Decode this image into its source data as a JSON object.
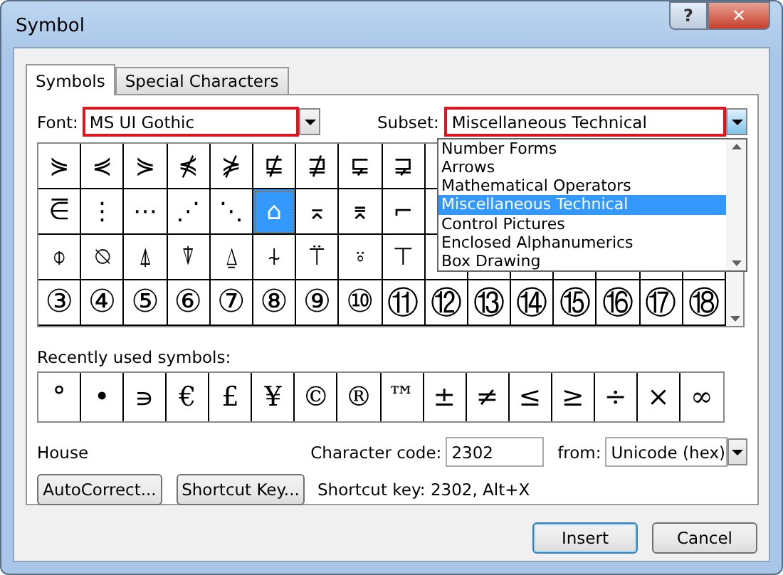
{
  "window": {
    "title": "Symbol",
    "help_button": "?",
    "close_button": "✕"
  },
  "tabs": [
    {
      "label": "Symbols",
      "selected": true
    },
    {
      "label": "Special Characters",
      "selected": false
    }
  ],
  "font": {
    "label": "Font:",
    "value": "MS UI Gothic",
    "highlighted": true
  },
  "subset": {
    "label": "Subset:",
    "value": "Miscellaneous Technical",
    "highlighted": true,
    "expanded": true,
    "options": [
      {
        "label": "Number Forms",
        "selected": false
      },
      {
        "label": "Arrows",
        "selected": false
      },
      {
        "label": "Mathematical Operators",
        "selected": false
      },
      {
        "label": "Miscellaneous Technical",
        "selected": true
      },
      {
        "label": "Control Pictures",
        "selected": false
      },
      {
        "label": "Enclosed Alphanumerics",
        "selected": false
      },
      {
        "label": "Box Drawing",
        "selected": false
      }
    ]
  },
  "symbol_grid": [
    [
      {
        "char": "⋟",
        "selected": false
      },
      {
        "char": "⋞",
        "selected": false
      },
      {
        "char": "⋟",
        "selected": false
      },
      {
        "char": "⋠",
        "selected": false
      },
      {
        "char": "⋡",
        "selected": false
      },
      {
        "char": "⋢",
        "selected": false
      },
      {
        "char": "⋣",
        "selected": false
      },
      {
        "char": "⋤",
        "selected": false
      },
      {
        "char": "⋥",
        "selected": false
      }
    ],
    [
      {
        "char": "⋶",
        "selected": false
      },
      {
        "char": "⋮",
        "selected": false
      },
      {
        "char": "⋯",
        "selected": false
      },
      {
        "char": "⋰",
        "selected": false
      },
      {
        "char": "⋱",
        "selected": false
      },
      {
        "char": "⌂",
        "selected": true
      },
      {
        "char": "⌅",
        "selected": false
      },
      {
        "char": "⌆",
        "selected": false
      },
      {
        "char": "⌐",
        "selected": false
      }
    ],
    [
      {
        "char": "⌽",
        "selected": false
      },
      {
        "char": "⍉",
        "selected": false
      },
      {
        "char": "⍋",
        "selected": false
      },
      {
        "char": "⍒",
        "selected": false
      },
      {
        "char": "⍙",
        "selected": false
      },
      {
        "char": "⍭",
        "selected": false
      },
      {
        "char": "⍡",
        "selected": false
      },
      {
        "char": "⍤",
        "selected": false
      },
      {
        "char": "⊤",
        "selected": false
      }
    ],
    [
      {
        "char": "③",
        "selected": false
      },
      {
        "char": "④",
        "selected": false
      },
      {
        "char": "⑤",
        "selected": false
      },
      {
        "char": "⑥",
        "selected": false
      },
      {
        "char": "⑦",
        "selected": false
      },
      {
        "char": "⑧",
        "selected": false
      },
      {
        "char": "⑨",
        "selected": false
      },
      {
        "char": "⑩",
        "selected": false
      },
      {
        "char": "⑪",
        "selected": false
      },
      {
        "char": "⑫",
        "selected": false
      },
      {
        "char": "⑬",
        "selected": false
      },
      {
        "char": "⑭",
        "selected": false
      },
      {
        "char": "⑮",
        "selected": false
      },
      {
        "char": "⑯",
        "selected": false
      },
      {
        "char": "⑰",
        "selected": false
      },
      {
        "char": "⑱",
        "selected": false
      }
    ]
  ],
  "recent": {
    "label": "Recently used symbols:",
    "symbols": [
      "°",
      "•",
      "∍",
      "€",
      "£",
      "¥",
      "©",
      "®",
      "™",
      "±",
      "≠",
      "≤",
      "≥",
      "÷",
      "×",
      "∞"
    ]
  },
  "symbol_name": "House",
  "character_code": {
    "label": "Character code:",
    "value": "2302"
  },
  "from": {
    "label": "from:",
    "value": "Unicode (hex)"
  },
  "autocorrect_button": "AutoCorrect...",
  "shortcut_key_button": "Shortcut Key...",
  "shortcut_text": "Shortcut key: 2302, Alt+X",
  "buttons": [
    {
      "label": "Insert",
      "default": true
    },
    {
      "label": "Cancel",
      "default": false
    }
  ]
}
